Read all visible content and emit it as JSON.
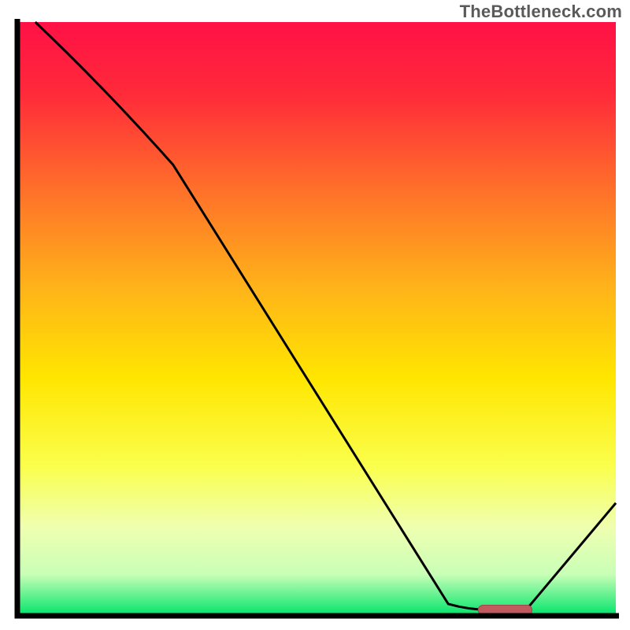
{
  "watermark": "TheBottleneck.com",
  "chart_data": {
    "type": "line",
    "title": "",
    "xlabel": "",
    "ylabel": "",
    "xlim": [
      0,
      100
    ],
    "ylim": [
      0,
      100
    ],
    "x": [
      3,
      26,
      72,
      79,
      85,
      100
    ],
    "values": [
      100,
      76,
      2,
      1,
      1,
      19
    ],
    "optimum_marker": {
      "x_start": 77,
      "x_end": 86,
      "y": 1
    },
    "gradient_stops": [
      {
        "offset": 0.0,
        "color": "#ff1146"
      },
      {
        "offset": 0.12,
        "color": "#ff2a3a"
      },
      {
        "offset": 0.28,
        "color": "#ff6f2a"
      },
      {
        "offset": 0.45,
        "color": "#ffb419"
      },
      {
        "offset": 0.6,
        "color": "#ffe600"
      },
      {
        "offset": 0.75,
        "color": "#faff4e"
      },
      {
        "offset": 0.85,
        "color": "#efffb0"
      },
      {
        "offset": 0.93,
        "color": "#c9ffb7"
      },
      {
        "offset": 1.0,
        "color": "#00e46a"
      }
    ],
    "colors": {
      "curve": "#000000",
      "marker_fill": "#c15a5e",
      "marker_stroke": "#a24548",
      "border": "#000000"
    }
  }
}
